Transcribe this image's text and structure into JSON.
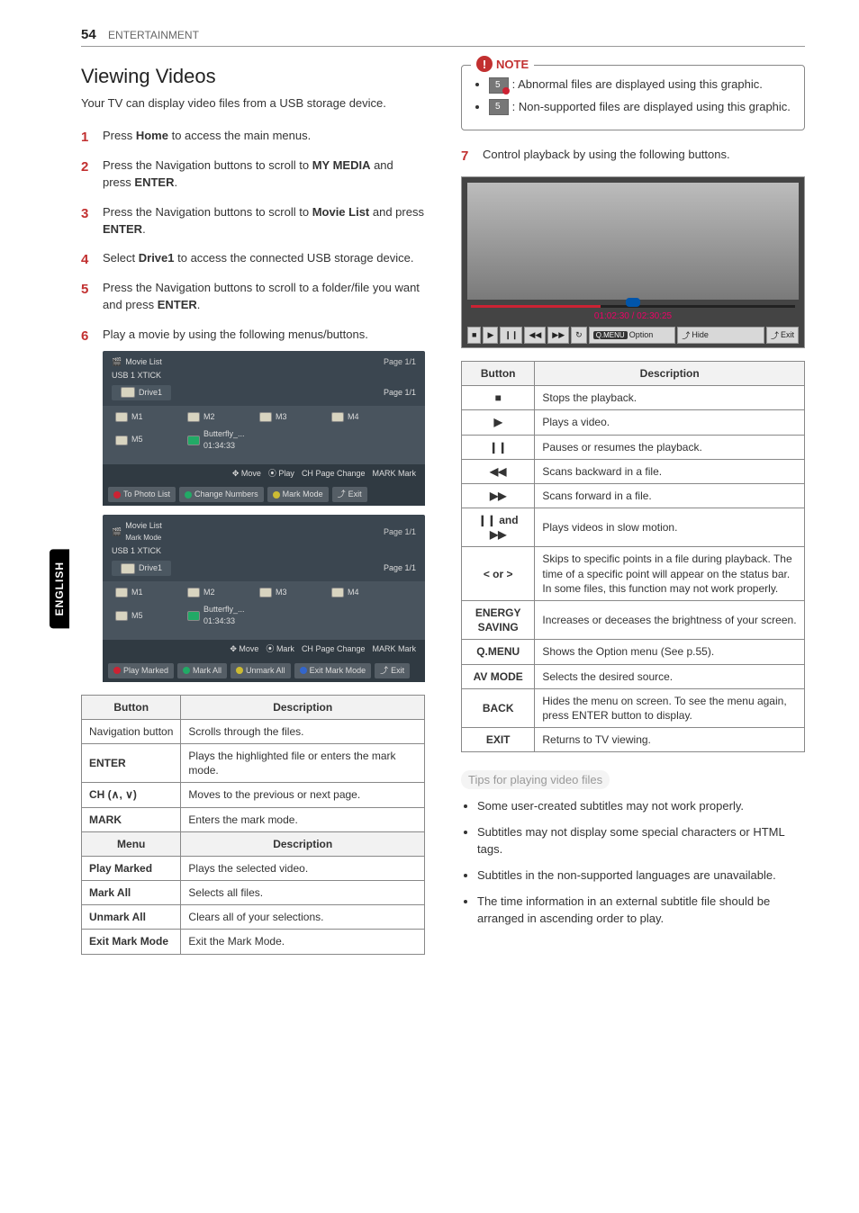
{
  "header": {
    "page_number": "54",
    "section": "ENTERTAINMENT"
  },
  "side_tab": "ENGLISH",
  "title": "Viewing Videos",
  "intro": "Your TV can display video files from a USB storage device.",
  "steps": [
    {
      "pre": "Press ",
      "b1": "Home",
      "post": " to access the main menus."
    },
    {
      "pre": "Press the Navigation buttons to scroll to ",
      "b1": "MY MEDIA",
      "mid": " and press ",
      "b2": "ENTER",
      "post": "."
    },
    {
      "pre": "Press the Navigation buttons to scroll to ",
      "b1": "Movie List",
      "mid": " and press ",
      "b2": "ENTER",
      "post": "."
    },
    {
      "pre": "Select ",
      "b1": "Drive1",
      "post": " to access the connected USB storage device."
    },
    {
      "pre": "Press the Navigation buttons to scroll to a folder/file you want and press ",
      "b1": "ENTER",
      "post": "."
    },
    {
      "pre": "Play a movie by using the following menus/buttons.",
      "b1": "",
      "post": ""
    }
  ],
  "panel1": {
    "title": "Movie List",
    "usb": "USB 1 XTICK",
    "page": "Page 1/1",
    "drive": "Drive1",
    "page2": "Page 1/1",
    "folders": [
      "M1",
      "M2",
      "M3",
      "M4",
      "M5"
    ],
    "video": {
      "name": "Butterfly_...",
      "time": "01:34:33"
    },
    "legend": {
      "move": "Move",
      "play": "Play",
      "pch": "Page Change",
      "mark": "Mark"
    },
    "buttons": [
      "To Photo List",
      "Change Numbers",
      "Mark Mode",
      "Exit"
    ]
  },
  "panel2": {
    "title": "Movie List",
    "subtitle": "Mark Mode",
    "usb": "USB 1 XTICK",
    "page": "Page 1/1",
    "drive": "Drive1",
    "page2": "Page 1/1",
    "folders": [
      "M1",
      "M2",
      "M3",
      "M4",
      "M5"
    ],
    "video": {
      "name": "Butterfly_...",
      "time": "01:34:33"
    },
    "legend": {
      "move": "Move",
      "mark": "Mark",
      "pch": "Page Change",
      "markall": "Mark"
    },
    "buttons": [
      "Play Marked",
      "Mark All",
      "Unmark All",
      "Exit Mark Mode",
      "Exit"
    ]
  },
  "button_table": {
    "headers": [
      "Button",
      "Description"
    ],
    "rows": [
      [
        "Navigation button",
        "Scrolls through the files."
      ],
      [
        "ENTER",
        "Plays the highlighted file or enters the mark mode."
      ],
      [
        "CH (∧, ∨)",
        "Moves to the previous or next page."
      ],
      [
        "MARK",
        "Enters the mark mode."
      ]
    ]
  },
  "menu_table": {
    "headers": [
      "Menu",
      "Description"
    ],
    "rows": [
      [
        "Play Marked",
        "Plays the selected video."
      ],
      [
        "Mark All",
        "Selects all files."
      ],
      [
        "Unmark All",
        "Clears all of your selections."
      ],
      [
        "Exit Mark Mode",
        "Exit the Mark Mode."
      ]
    ]
  },
  "note": {
    "label": "NOTE",
    "items": [
      ": Abnormal files are displayed using this graphic.",
      ": Non-supported files are displayed using this graphic."
    ]
  },
  "step7": "Control playback by using the following buttons.",
  "preview": {
    "time": "01:02:30 / 02:30:25",
    "controls": {
      "option": "Option",
      "option_badge": "Q.MENU",
      "hide": "Hide",
      "exit": "Exit"
    }
  },
  "playback_table": {
    "headers": [
      "Button",
      "Description"
    ],
    "rows": [
      [
        "■",
        "Stops the playback."
      ],
      [
        "▶",
        "Plays a video."
      ],
      [
        "❙❙",
        "Pauses or resumes the playback."
      ],
      [
        "◀◀",
        "Scans backward in a file."
      ],
      [
        "▶▶",
        "Scans forward in a file."
      ],
      [
        "❙❙ and ▶▶",
        "Plays videos in slow motion."
      ],
      [
        "< or >",
        "Skips to specific points in a file during playback. The time of a specific point will appear on the status bar. In some files, this function may not work properly."
      ],
      [
        "ENERGY SAVING",
        "Increases or deceases the brightness of your screen."
      ],
      [
        "Q.MENU",
        "Shows the Option menu (See p.55)."
      ],
      [
        "AV MODE",
        "Selects the desired source."
      ],
      [
        "BACK",
        "Hides the menu on screen. To see the menu again, press ENTER button to display."
      ],
      [
        "EXIT",
        "Returns to TV viewing."
      ]
    ]
  },
  "tips_heading": "Tips for playing video files",
  "tips": [
    "Some user-created subtitles may not work properly.",
    "Subtitles may not display some special characters or HTML tags.",
    "Subtitles in the non-supported languages are unavailable.",
    "The time information in an external subtitle file should be arranged in ascending order to play."
  ]
}
